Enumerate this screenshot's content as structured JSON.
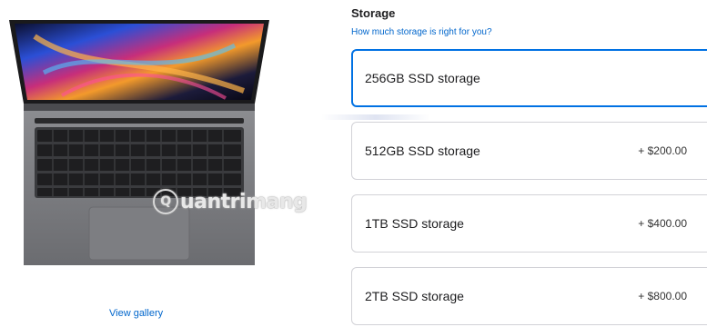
{
  "product": {
    "gallery_link": "View gallery",
    "watermark": "uantrimang"
  },
  "storage": {
    "title": "Storage",
    "help_link": "How much storage is right for you?",
    "options": [
      {
        "label": "256GB SSD storage",
        "price": "",
        "selected": true
      },
      {
        "label": "512GB SSD storage",
        "price": "+ $200.00",
        "selected": false
      },
      {
        "label": "1TB SSD storage",
        "price": "+ $400.00",
        "selected": false
      },
      {
        "label": "2TB SSD storage",
        "price": "+ $800.00",
        "selected": false
      }
    ]
  },
  "colors": {
    "accent": "#0071e3",
    "link": "#0066cc",
    "border": "#d2d2d7",
    "laptop_body": "#6e6f73"
  }
}
